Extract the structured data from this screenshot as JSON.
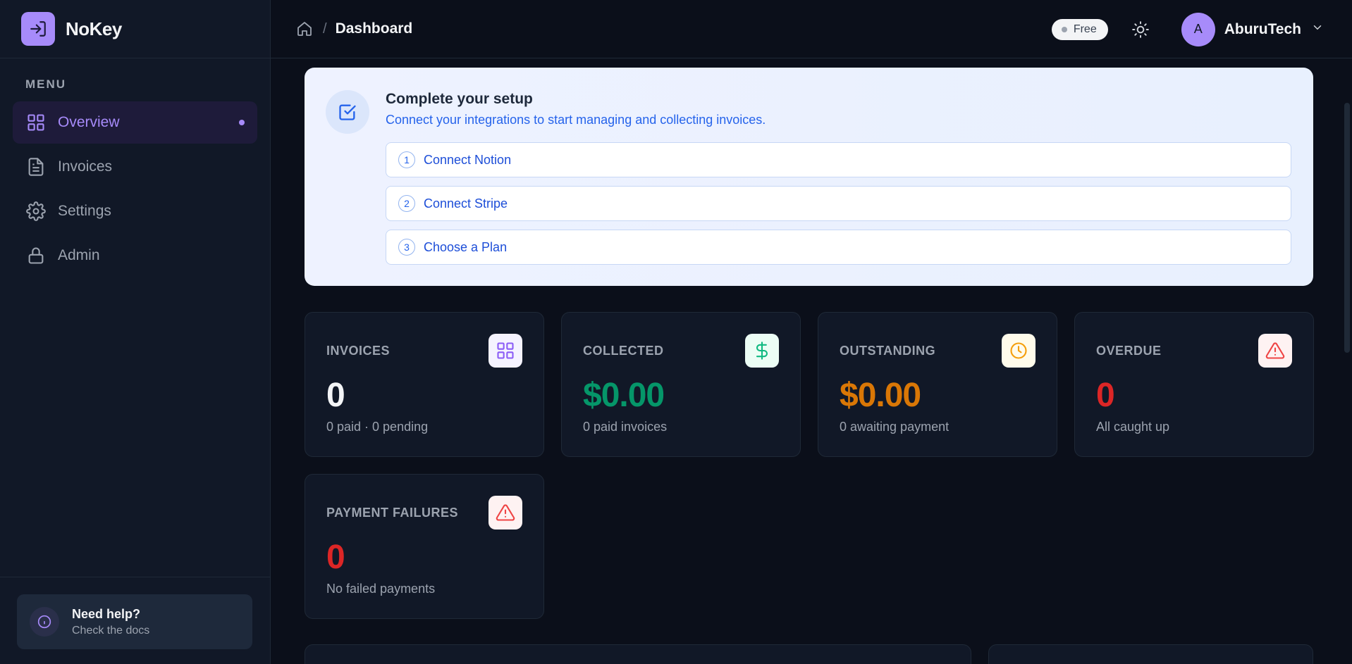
{
  "app": {
    "name": "NoKey"
  },
  "sidebar": {
    "menu_label": "MENU",
    "items": [
      {
        "label": "Overview",
        "icon": "grid-icon",
        "active": true
      },
      {
        "label": "Invoices",
        "icon": "file-icon",
        "active": false
      },
      {
        "label": "Settings",
        "icon": "gear-icon",
        "active": false
      },
      {
        "label": "Admin",
        "icon": "lock-icon",
        "active": false
      }
    ],
    "help": {
      "title": "Need help?",
      "subtitle": "Check the docs"
    }
  },
  "header": {
    "breadcrumb_sep": "/",
    "breadcrumb_current": "Dashboard",
    "plan_badge": "Free",
    "user": {
      "initial": "A",
      "name": "AburuTech"
    }
  },
  "setup": {
    "title": "Complete your setup",
    "subtitle": "Connect your integrations to start managing and collecting invoices.",
    "steps": [
      {
        "num": "1",
        "label": "Connect Notion"
      },
      {
        "num": "2",
        "label": "Connect Stripe"
      },
      {
        "num": "3",
        "label": "Choose a Plan"
      }
    ]
  },
  "stats": [
    {
      "label": "INVOICES",
      "value": "0",
      "sub": "0 paid · 0 pending",
      "icon": "grid-icon",
      "color": "#f3f4f6",
      "icon_color": "#8b5cf6",
      "icon_bg": "#f5f3ff"
    },
    {
      "label": "COLLECTED",
      "value": "$0.00",
      "sub": "0 paid invoices",
      "icon": "dollar-icon",
      "color": "#059669",
      "icon_color": "#10b981",
      "icon_bg": "#ecfdf5"
    },
    {
      "label": "OUTSTANDING",
      "value": "$0.00",
      "sub": "0 awaiting payment",
      "icon": "clock-icon",
      "color": "#d97706",
      "icon_color": "#f59e0b",
      "icon_bg": "#fffbeb"
    },
    {
      "label": "OVERDUE",
      "value": "0",
      "sub": "All caught up",
      "icon": "alert-triangle-icon",
      "color": "#dc2626",
      "icon_color": "#ef4444",
      "icon_bg": "#fef2f2"
    },
    {
      "label": "PAYMENT FAILURES",
      "value": "0",
      "sub": "No failed payments",
      "icon": "alert-triangle-icon",
      "color": "#dc2626",
      "icon_color": "#ef4444",
      "icon_bg": "#fef2f2"
    }
  ]
}
